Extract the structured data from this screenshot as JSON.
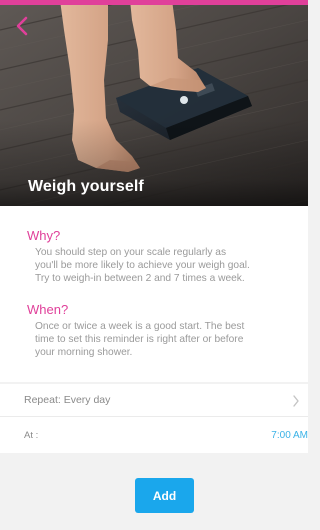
{
  "header": {
    "title": "Weigh yourself",
    "back_icon": "chevron-left-icon",
    "accent_color": "#e0409a"
  },
  "why": {
    "title": "Why?",
    "lines": [
      "You should step on your scale regularly as",
      "you'll be more likely to achieve your weigh goal.",
      "Try to weigh-in between 2 and 7 times a week."
    ]
  },
  "when": {
    "title": "When?",
    "lines": [
      "Once or twice a week is a good start. The best",
      "time to set this reminder is right after or before",
      "your morning shower."
    ]
  },
  "repeat": {
    "label": "Repeat: Every day",
    "icon": "chevron-right-icon"
  },
  "at": {
    "label": "At :",
    "value": "7:00 AM"
  },
  "actions": {
    "add_label": "Add",
    "button_color": "#1aa7ec"
  }
}
